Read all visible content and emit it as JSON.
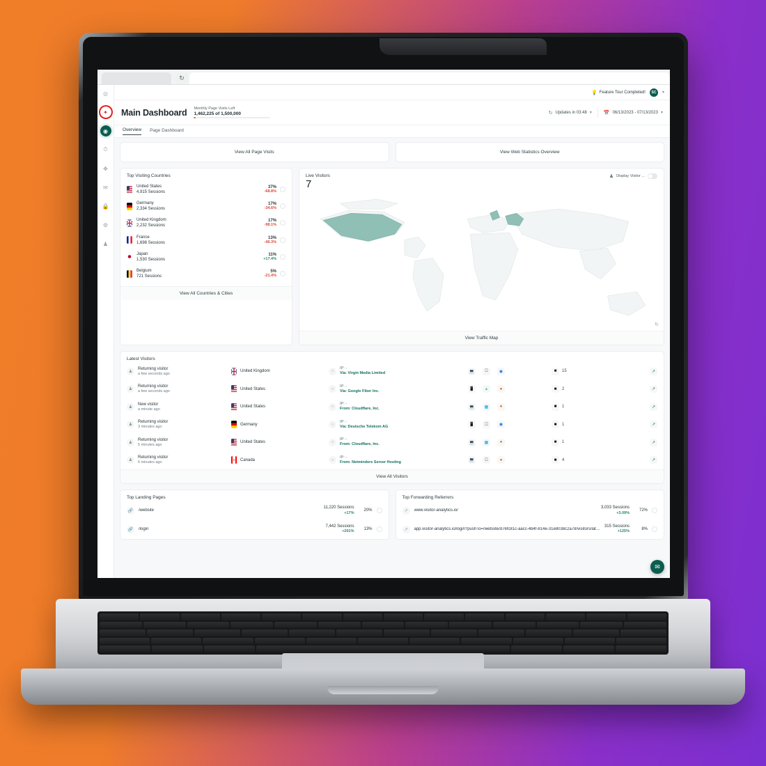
{
  "browser": {
    "refresh_icon": "refresh-icon"
  },
  "sidebar": {
    "items": [
      {
        "name": "sidebar-item-dashboard",
        "icon": "gauge-icon",
        "state": "default"
      },
      {
        "name": "sidebar-item-highlighted",
        "icon": "pin-icon",
        "state": "marked"
      },
      {
        "name": "sidebar-item-visitors",
        "icon": "users-icon",
        "state": "active"
      },
      {
        "name": "sidebar-item-sessions",
        "icon": "clock-icon",
        "state": "default"
      },
      {
        "name": "sidebar-item-behaviour",
        "icon": "flow-icon",
        "state": "default"
      },
      {
        "name": "sidebar-item-campaigns",
        "icon": "megaphone-icon",
        "state": "default"
      },
      {
        "name": "sidebar-item-security",
        "icon": "lock-icon",
        "state": "default"
      },
      {
        "name": "sidebar-item-settings",
        "icon": "gear-icon",
        "state": "default"
      },
      {
        "name": "sidebar-item-account",
        "icon": "person-icon",
        "state": "default"
      }
    ]
  },
  "topbar": {
    "tour_label": "Feature Tour Completed!",
    "bulb_icon": "lightbulb-icon",
    "avatar_initials": "SC",
    "avatar_caret": "⌄"
  },
  "header": {
    "title": "Main Dashboard",
    "quota_label": "Monthly Page Visits Left",
    "quota_value": "1,462,225 of 1,500,000",
    "updates_label": "Updates in 03:48",
    "updates_icon": "refresh-icon",
    "date_range": "06/13/2023 - 07/13/2023",
    "calendar_icon": "calendar-icon",
    "caret": "⌄"
  },
  "tabs": [
    {
      "label": "Overview",
      "active": true
    },
    {
      "label": "Page Dashboard",
      "active": false
    }
  ],
  "quick_buttons": [
    {
      "label": "View All Page Visits"
    },
    {
      "label": "View Web Statistics Overview"
    }
  ],
  "countries_card": {
    "title": "Top Visiting Countries",
    "footer": "View All Countries & Cities",
    "rows": [
      {
        "country": "United States",
        "sessions": "4,915 Sessions",
        "pct": "37%",
        "delta": "-68.8%",
        "dir": "neg",
        "flag": "us"
      },
      {
        "country": "Germany",
        "sessions": "2,334 Sessions",
        "pct": "17%",
        "delta": "-34.6%",
        "dir": "neg",
        "flag": "de"
      },
      {
        "country": "United Kingdom",
        "sessions": "2,232 Sessions",
        "pct": "17%",
        "delta": "-98.1%",
        "dir": "neg",
        "flag": "gb"
      },
      {
        "country": "France",
        "sessions": "1,698 Sessions",
        "pct": "13%",
        "delta": "-46.3%",
        "dir": "neg",
        "flag": "fr"
      },
      {
        "country": "Japan",
        "sessions": "1,530 Sessions",
        "pct": "11%",
        "delta": "+17.4%",
        "dir": "pos",
        "flag": "jp"
      },
      {
        "country": "Belgium",
        "sessions": "721 Sessions",
        "pct": "5%",
        "delta": "-21.4%",
        "dir": "neg",
        "flag": "be"
      }
    ]
  },
  "live_card": {
    "title": "Live Visitors",
    "count": "7",
    "toggle_label": "Display Visitor ...",
    "toggle_icon": "person-icon",
    "toggle_on": false,
    "footer": "View Traffic Map",
    "reload_icon": "refresh-icon",
    "highlighted_countries": [
      "United States",
      "Germany",
      "United Kingdom"
    ],
    "map_fill": "#8fbfb5",
    "map_base": "#f2f5f5"
  },
  "visitors_card": {
    "title": "Latest Visitors",
    "footer": "View All Visitors",
    "rows": [
      {
        "type": "Returning visitor",
        "time": "a few seconds ago",
        "country": "United Kingdom",
        "flag": "gb",
        "ip": "IP: -",
        "via": "Via: Virgin Media Limited",
        "devices": [
          "desktop-icon",
          "apple-icon",
          "chrome-icon"
        ],
        "pages": "15"
      },
      {
        "type": "Returning visitor",
        "time": "a few seconds ago",
        "country": "United States",
        "flag": "us",
        "ip": "IP: -",
        "via": "Via: Google Fiber Inc.",
        "devices": [
          "mobile-icon",
          "android-icon",
          "firefox-icon"
        ],
        "pages": "2"
      },
      {
        "type": "New visitor",
        "time": "a minute ago",
        "country": "United States",
        "flag": "us",
        "ip": "IP: -",
        "via": "From: Cloudflare, Inc.",
        "devices": [
          "desktop-icon",
          "windows-icon",
          "firefox-icon"
        ],
        "pages": "1"
      },
      {
        "type": "Returning visitor",
        "time": "3 minutes ago",
        "country": "Germany",
        "flag": "de",
        "ip": "IP: -",
        "via": "Via: Deutsche Telekom AG",
        "devices": [
          "mobile-icon",
          "apple-icon",
          "chrome-icon"
        ],
        "pages": "1"
      },
      {
        "type": "Returning visitor",
        "time": "5 minutes ago",
        "country": "United States",
        "flag": "us",
        "ip": "IP: -",
        "via": "From: Cloudflare, Inc.",
        "devices": [
          "desktop-icon",
          "windows-icon",
          "firefox-icon"
        ],
        "pages": "1"
      },
      {
        "type": "Returning visitor",
        "time": "6 minutes ago",
        "country": "Canada",
        "flag": "ca",
        "ip": "IP: -",
        "via": "From: Netminders Server Hosting",
        "devices": [
          "desktop-icon",
          "apple-icon",
          "firefox-icon"
        ],
        "pages": "4"
      }
    ]
  },
  "landing_card": {
    "title": "Top Landing Pages",
    "rows": [
      {
        "label": "/website",
        "sessions": "11,220 Sessions",
        "delta": "+17%",
        "pct": "20%"
      },
      {
        "label": "/login",
        "sessions": "7,442 Sessions",
        "delta": "+201%",
        "pct": "13%"
      }
    ]
  },
  "referrers_card": {
    "title": "Top Forwarding Referrers",
    "rows": [
      {
        "label": "www.visitor-analytics.io/",
        "sessions": "3,033 Sessions",
        "delta": "+3.09%",
        "pct": "72%"
      },
      {
        "label": "app.visitor-analytics.io/login?pushTo=/website/d76fc81c-aacc-4b4f-814e-31e8038c2a78/visitors/latest",
        "sessions": "315 Sessions",
        "delta": "+125%",
        "pct": "8%"
      }
    ]
  },
  "fab": {
    "icon": "chat-support-icon",
    "color": "#0c5d50"
  }
}
